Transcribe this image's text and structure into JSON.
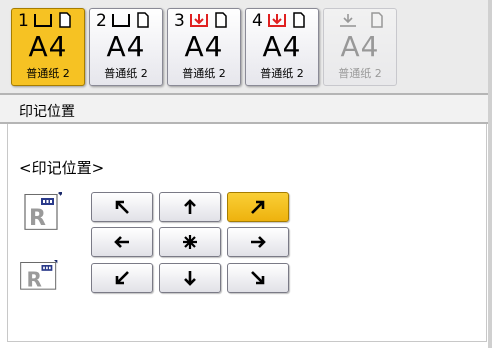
{
  "trays": [
    {
      "number": "1",
      "size": "A4",
      "paper_type": "普通纸 2",
      "selected": true,
      "disabled": false,
      "tray_icon": "tray-icon",
      "paper_icon": "portrait-paper-icon"
    },
    {
      "number": "2",
      "size": "A4",
      "paper_type": "普通纸 2",
      "selected": false,
      "disabled": false,
      "tray_icon": "tray-icon",
      "paper_icon": "portrait-paper-icon"
    },
    {
      "number": "3",
      "size": "A4",
      "paper_type": "普通纸 2",
      "selected": false,
      "disabled": false,
      "tray_icon": "tray-empty-icon",
      "paper_icon": "portrait-paper-icon"
    },
    {
      "number": "4",
      "size": "A4",
      "paper_type": "普通纸 2",
      "selected": false,
      "disabled": false,
      "tray_icon": "tray-empty-icon",
      "paper_icon": "portrait-paper-icon"
    },
    {
      "number": "",
      "size": "A4",
      "paper_type": "普通纸 2",
      "selected": false,
      "disabled": true,
      "tray_icon": "bypass-tray-icon",
      "paper_icon": "portrait-paper-icon"
    }
  ],
  "section_title": "印记位置",
  "group_label": "<印记位置>",
  "orientation_icons": [
    "portrait-original-icon",
    "landscape-original-icon"
  ],
  "positions": [
    {
      "id": "top-left",
      "icon": "arrow-up-left-icon",
      "selected": false
    },
    {
      "id": "top-center",
      "icon": "arrow-up-icon",
      "selected": false
    },
    {
      "id": "top-right",
      "icon": "arrow-up-right-icon",
      "selected": true
    },
    {
      "id": "center-left",
      "icon": "arrow-left-icon",
      "selected": false
    },
    {
      "id": "center",
      "icon": "center-icon",
      "selected": false
    },
    {
      "id": "center-right",
      "icon": "arrow-right-icon",
      "selected": false
    },
    {
      "id": "bottom-left",
      "icon": "arrow-down-left-icon",
      "selected": false
    },
    {
      "id": "bottom-center",
      "icon": "arrow-down-icon",
      "selected": false
    },
    {
      "id": "bottom-right",
      "icon": "arrow-down-right-icon",
      "selected": false
    }
  ],
  "colors": {
    "accent": "#f6c223",
    "alert": "#e02020",
    "border": "#7a7a86"
  }
}
